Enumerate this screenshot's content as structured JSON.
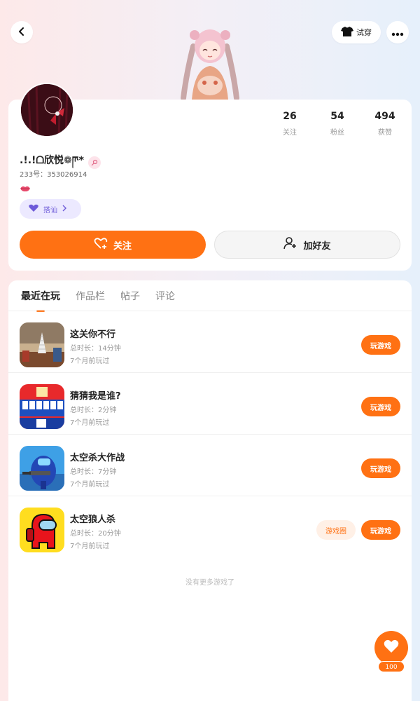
{
  "header": {
    "tryon_label": "试穿",
    "icons": [
      "back-arrow-icon",
      "shirt-icon",
      "more-dots-icon"
    ]
  },
  "profile": {
    "stats": [
      {
        "value": "26",
        "label": "关注"
      },
      {
        "value": "54",
        "label": "粉丝"
      },
      {
        "value": "494",
        "label": "获赞"
      }
    ],
    "nickname": ".!.!ᗝ欣悦❁ཫ*",
    "uid": "233号：353026914",
    "tag_label": "搭讪",
    "follow_label": "关注",
    "add_friend_label": "加好友"
  },
  "tabs": [
    "最近在玩",
    "作品栏",
    "帖子",
    "评论"
  ],
  "games": [
    {
      "title": "这关你不行",
      "duration": "总时长：14分钟",
      "ago": "7个月前玩过",
      "button": "玩游戏"
    },
    {
      "title": "猜猜我是谁?",
      "duration": "总时长：2分钟",
      "ago": "7个月前玩过",
      "button": "玩游戏"
    },
    {
      "title": "太空杀大作战",
      "duration": "总时长：7分钟",
      "ago": "7个月前玩过",
      "button": "玩游戏"
    },
    {
      "title": "太空狼人杀",
      "duration": "总时长：20分钟",
      "ago": "7个月前玩过",
      "button": "玩游戏",
      "circle_button": "游戏圈"
    }
  ],
  "no_more_text": "没有更多游戏了",
  "like_count": "100",
  "colors": {
    "accent": "#ff7113",
    "tag_bg": "#ece9ff",
    "tag_fg": "#6e5bd9"
  }
}
